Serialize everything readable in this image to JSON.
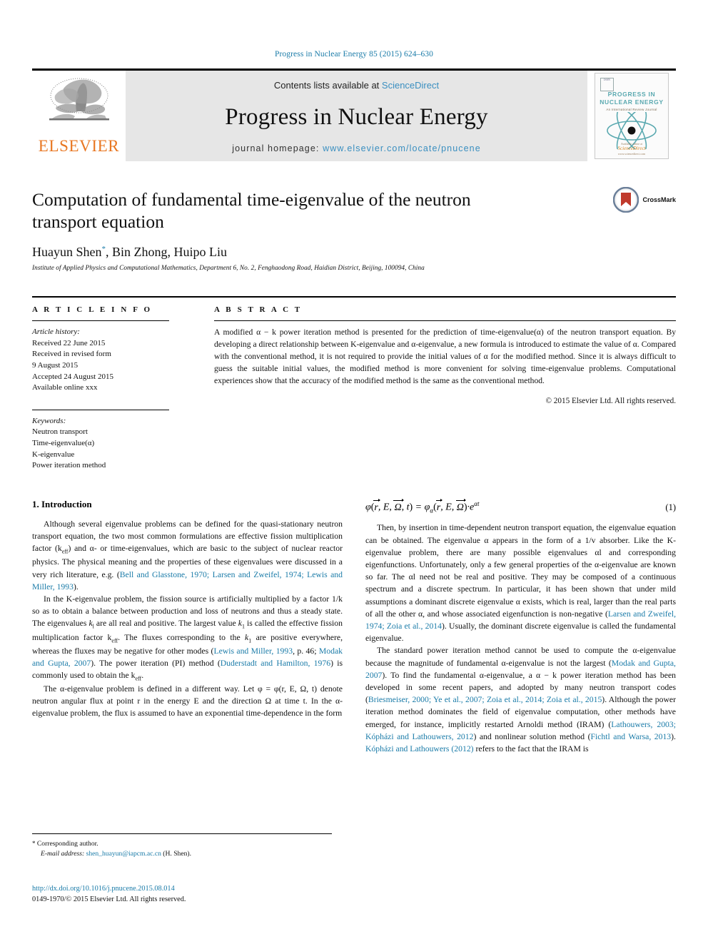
{
  "running_head": "Progress in Nuclear Energy 85 (2015) 624–630",
  "masthead": {
    "publisher_name": "ELSEVIER",
    "publisher_logo_alt": "elsevier-tree-logo",
    "contents_prefix": "Contents lists available at ",
    "contents_link": "ScienceDirect",
    "journal_title": "Progress in Nuclear Energy",
    "homepage_prefix": "journal homepage: ",
    "homepage_url": "www.elsevier.com/locate/pnucene",
    "cover": {
      "title": "PROGRESS IN NUCLEAR ENERGY",
      "subtitle": "An International Review Journal",
      "footer_brand": "ScienceDirect",
      "footer_note": "Available online at",
      "footer_url": "www.sciencedirect.com"
    }
  },
  "article": {
    "title": "Computation of fundamental time-eigenvalue of the neutron transport equation",
    "authors": "Huayun Shen",
    "author_mark": "*",
    "authors_rest": ", Bin Zhong, Huipo Liu",
    "affiliation": "Institute of Applied Physics and Computational Mathematics, Department 6, No. 2, Fenghaodong Road, Haidian District, Beijing, 100094, China",
    "crossmark_label": "CrossMark"
  },
  "info": {
    "heading": "A R T I C L E   I N F O",
    "history_label": "Article history:",
    "history": [
      "Received 22 June 2015",
      "Received in revised form",
      "9 August 2015",
      "Accepted 24 August 2015",
      "Available online xxx"
    ],
    "keywords_label": "Keywords:",
    "keywords": [
      "Neutron transport",
      "Time-eigenvalue(α)",
      "K-eigenvalue",
      "Power iteration method"
    ]
  },
  "abstract": {
    "heading": "A B S T R A C T",
    "text": "A modified α − k power iteration method is presented for the prediction of time-eigenvalue(α) of the neutron transport equation. By developing a direct relationship between K-eigenvalue and α-eigenvalue, a new formula is introduced to estimate the value of α. Compared with the conventional method, it is not required to provide the initial values of α for the modified method. Since it is always difficult to guess the suitable initial values, the modified method is more convenient for solving time-eigenvalue problems. Computational experiences show that the accuracy of the modified method is the same as the conventional method.",
    "copyright": "© 2015 Elsevier Ltd. All rights reserved."
  },
  "body": {
    "section_title": "1. Introduction",
    "left_paragraphs": [
      "Although several eigenvalue problems can be defined for the quasi-stationary neutron transport equation, the two most common formulations are effective fission multiplication factor (keff) and α- or time-eigenvalues, which are basic to the subject of nuclear reactor physics. The physical meaning and the properties of these eigenvalues were discussed in a very rich literature, e.g. (Bell and Glasstone, 1970; Larsen and Zweifel, 1974; Lewis and Miller, 1993).",
      "In the K-eigenvalue problem, the fission source is artificially multiplied by a factor 1/k so as to obtain a balance between production and loss of neutrons and thus a steady state. The eigenvalues kl are all real and positive. The largest value k1 is called the effective fission multiplication factor keff. The fluxes corresponding to the k1 are positive everywhere, whereas the fluxes may be negative for other modes (Lewis and Miller, 1993, p. 46; Modak and Gupta, 2007). The power iteration (PI) method (Duderstadt and Hamilton, 1976) is commonly used to obtain the keff.",
      "The α-eigenvalue problem is defined in a different way. Let φ = φ(r, E, Ω, t) denote neutron angular flux at point r in the energy E and the direction Ω at time t. In the α-eigenvalue problem, the flux is assumed to have an exponential time-dependence in the form"
    ],
    "equation": {
      "number": "(1)",
      "latex_like": "φ(r⃗, E, Ω⃗, t) = φα(r⃗, E, Ω⃗)·e^{αt}"
    },
    "right_paragraphs": [
      "Then, by insertion in time-dependent neutron transport equation, the eigenvalue equation can be obtained. The eigenvalue α appears in the form of a 1/v absorber. Like the K-eigenvalue problem, there are many possible eigenvalues αl and corresponding eigenfunctions. Unfortunately, only a few general properties of the α-eigenvalue are known so far. The αl need not be real and positive. They may be composed of a continuous spectrum and a discrete spectrum. In particular, it has been shown that under mild assumptions a dominant discrete eigenvalue α exists, which is real, larger than the real parts of all the other α, and whose associated eigenfunction is non-negative (Larsen and Zweifel, 1974; Zoia et al., 2014). Usually, the dominant discrete eigenvalue is called the fundamental eigenvalue.",
      "The standard power iteration method cannot be used to compute the α-eigenvalue because the magnitude of fundamental α-eigenvalue is not the largest (Modak and Gupta, 2007). To find the fundamental α-eigenvalue, a α − k power iteration method has been developed in some recent papers, and adopted by many neutron transport codes (Briesmeiser, 2000; Ye et al., 2007; Zoia et al., 2014; Zoia et al., 2015). Although the power iteration method dominates the field of eigenvalue computation, other methods have emerged, for instance, implicitly restarted Arnoldi method (IRAM) (Lathouwers, 2003; Kópházi and Lathouwers, 2012) and nonlinear solution method (Fichtl and Warsa, 2013). Kópházi and Lathouwers (2012) refers to the fact that the IRAM is"
    ]
  },
  "footnote": {
    "star": "*",
    "corresponding": "Corresponding author.",
    "email_label": "E-mail address:",
    "email": "shen_huayun@iapcm.ac.cn",
    "email_suffix": "(H. Shen)."
  },
  "bottom": {
    "doi": "http://dx.doi.org/10.1016/j.pnucene.2015.08.014",
    "issn_line": "0149-1970/© 2015 Elsevier Ltd. All rights reserved."
  },
  "colors": {
    "link": "#1a7ba8",
    "elsevier_orange": "#E87722",
    "masthead_grey": "#e6e6e6",
    "cover_teal": "#5aa9b0",
    "crossmark_red": "#c0392b"
  }
}
